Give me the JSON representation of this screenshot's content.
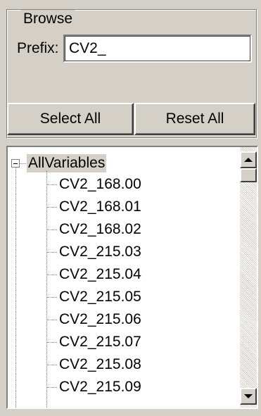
{
  "browse": {
    "title": "Browse",
    "prefix_label": "Prefix:",
    "prefix_value": "CV2_",
    "select_all_label": "Select All",
    "reset_all_label": "Reset All"
  },
  "tree": {
    "root_label": "AllVariables",
    "expander_icon": "minus-box-icon",
    "items": [
      {
        "label": "CV2_168.00"
      },
      {
        "label": "CV2_168.01"
      },
      {
        "label": "CV2_168.02"
      },
      {
        "label": "CV2_215.03"
      },
      {
        "label": "CV2_215.04"
      },
      {
        "label": "CV2_215.05"
      },
      {
        "label": "CV2_215.06"
      },
      {
        "label": "CV2_215.07"
      },
      {
        "label": "CV2_215.08"
      },
      {
        "label": "CV2_215.09"
      }
    ]
  },
  "scrollbar": {
    "up_icon": "arrow-up-icon",
    "down_icon": "arrow-down-icon"
  },
  "colors": {
    "window_background": "#d4d0c8",
    "tree_background": "#ffffff",
    "root_highlight": "#d4d0c8"
  }
}
